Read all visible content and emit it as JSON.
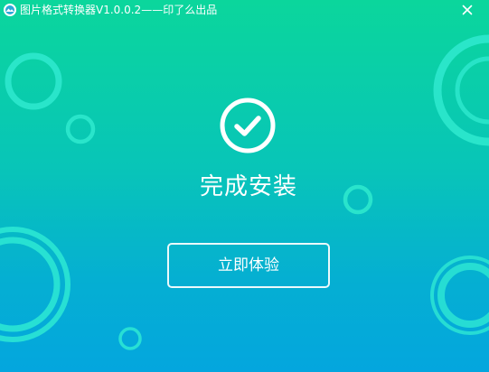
{
  "window": {
    "title": "图片格式转换器V1.0.0.2——印了么出品",
    "close_label": "✕"
  },
  "install": {
    "status": "完成安装",
    "action_label": "立即体验"
  },
  "icons": {
    "app": "app-logo-icon",
    "close": "close-icon",
    "success": "checkmark-circle-icon"
  },
  "colors": {
    "gradient_top": "#0bd69c",
    "gradient_bottom": "#04a6de",
    "ring": "#2ee9cf",
    "text": "#ffffff"
  }
}
